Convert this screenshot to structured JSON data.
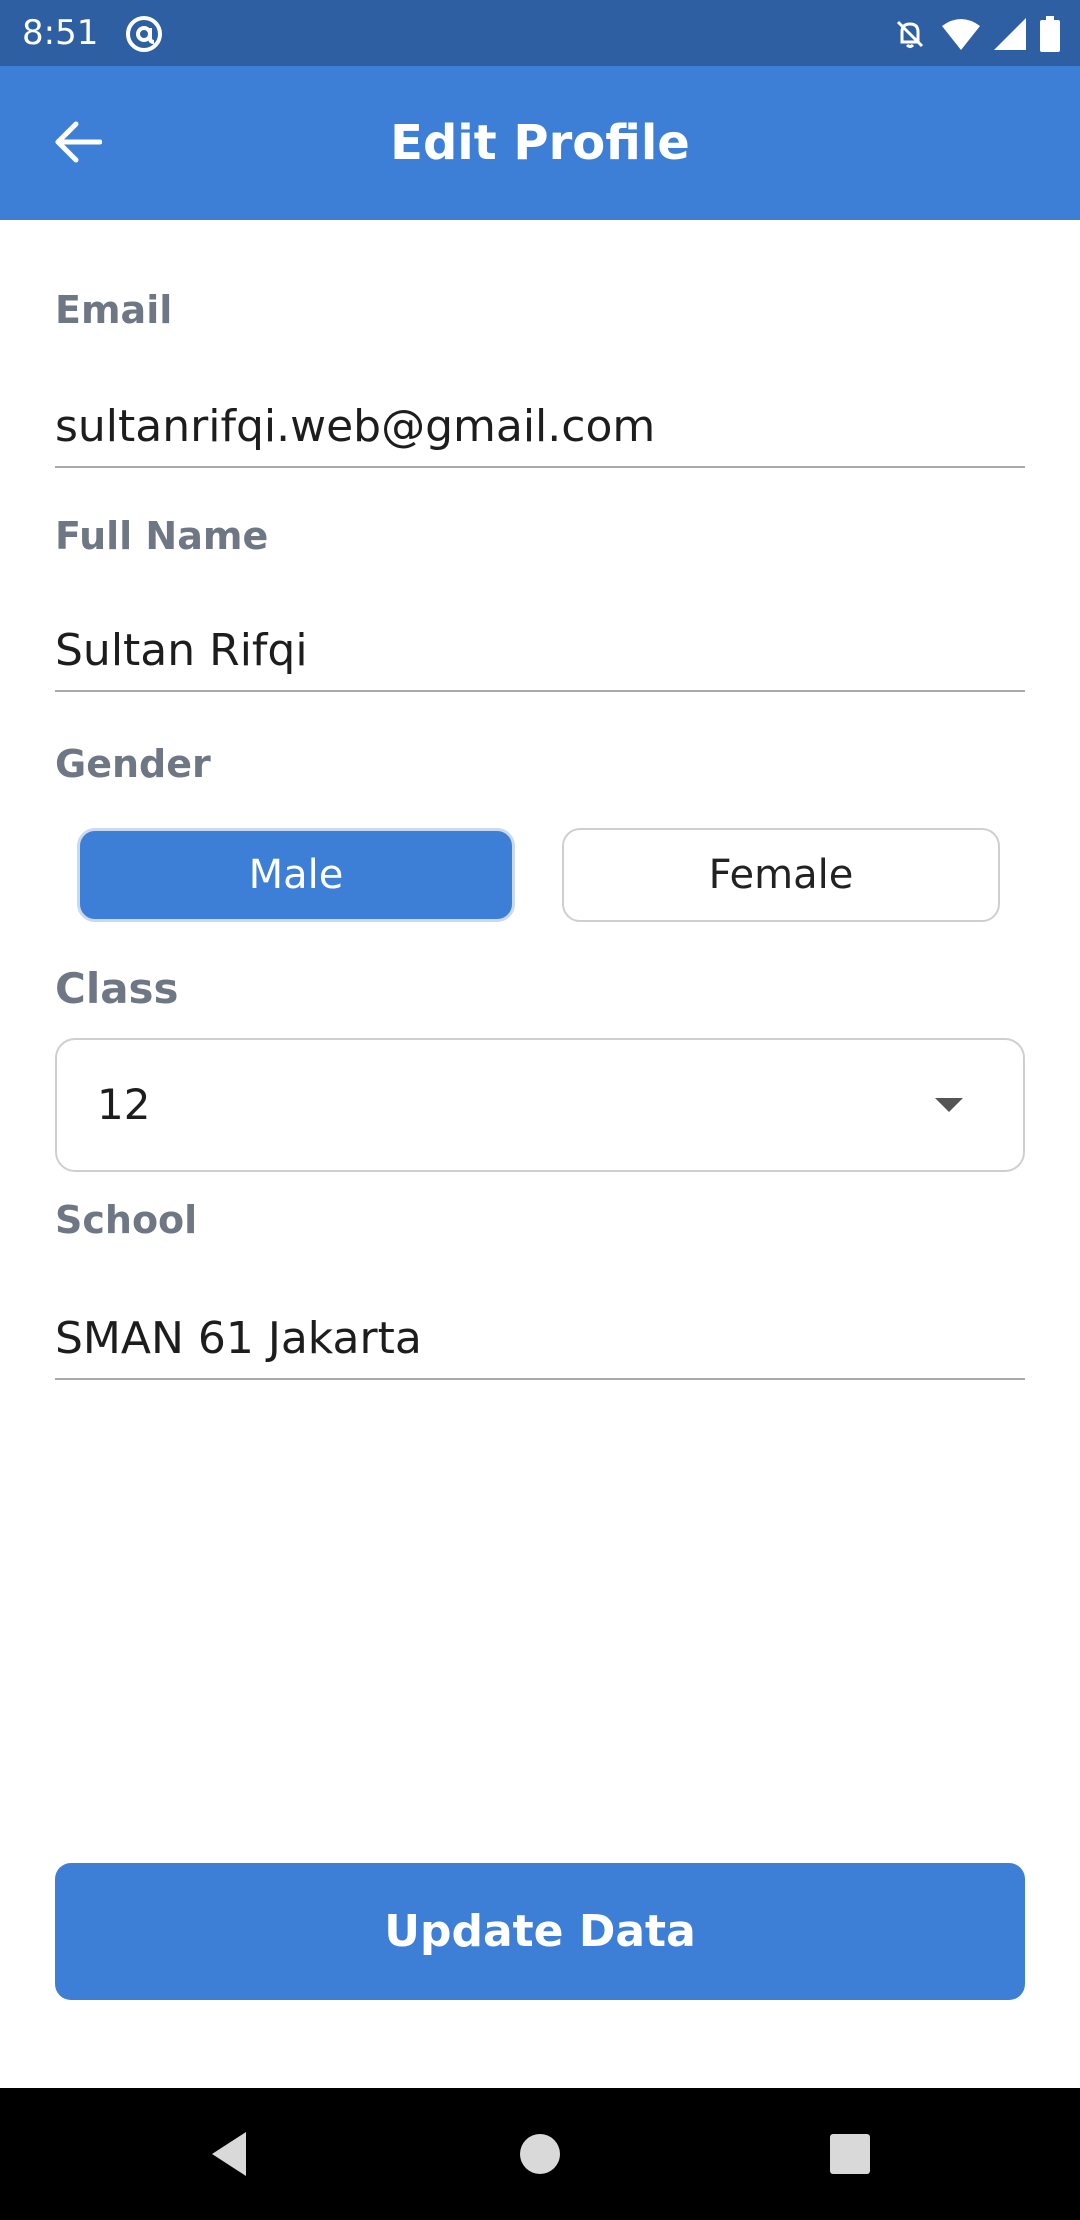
{
  "status_bar": {
    "time": "8:51",
    "icons": [
      "at-sign-icon",
      "notifications-off-icon",
      "wifi-icon",
      "signal-icon",
      "battery-icon"
    ]
  },
  "app_bar": {
    "title": "Edit Profile",
    "back_icon": "arrow-left-icon"
  },
  "form": {
    "email": {
      "label": "Email",
      "value": "sultanrifqi.web@gmail.com"
    },
    "full_name": {
      "label": "Full Name",
      "value": "Sultan Rifqi"
    },
    "gender": {
      "label": "Gender",
      "options": [
        "Male",
        "Female"
      ],
      "selected": "Male"
    },
    "class": {
      "label": "Class",
      "value": "12"
    },
    "school": {
      "label": "School",
      "value": "SMAN 61 Jakarta"
    }
  },
  "actions": {
    "update_label": "Update Data"
  },
  "nav_bar": {
    "icons": [
      "back-triangle-icon",
      "home-circle-icon",
      "recents-square-icon"
    ]
  },
  "colors": {
    "primary": "#3d7fd6",
    "status_bar": "#2f5fa3",
    "label": "#6f7784"
  }
}
